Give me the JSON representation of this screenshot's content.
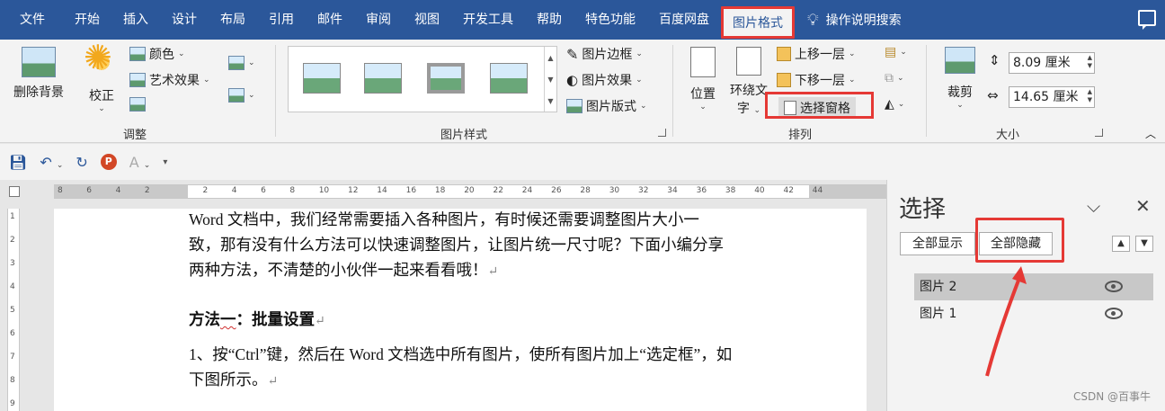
{
  "tabs": [
    {
      "label": "文件"
    },
    {
      "label": "开始"
    },
    {
      "label": "插入"
    },
    {
      "label": "设计"
    },
    {
      "label": "布局"
    },
    {
      "label": "引用"
    },
    {
      "label": "邮件"
    },
    {
      "label": "审阅"
    },
    {
      "label": "视图"
    },
    {
      "label": "开发工具"
    },
    {
      "label": "帮助"
    },
    {
      "label": "特色功能"
    },
    {
      "label": "百度网盘"
    },
    {
      "label": "图片格式"
    }
  ],
  "tell_me": "操作说明搜索",
  "ribbon": {
    "adjust": {
      "remove_bg": "删除背景",
      "correct": "校正",
      "color": "颜色",
      "artistic": "艺术效果",
      "group_label": "调整"
    },
    "styles": {
      "border": "图片边框",
      "effects": "图片效果",
      "layout": "图片版式",
      "group_label": "图片样式"
    },
    "arrange": {
      "position": "位置",
      "wrap_line1": "环绕文",
      "wrap_line2": "字",
      "bring_forward": "上移一层",
      "send_backward": "下移一层",
      "selection_pane": "选择窗格",
      "group_label": "排列"
    },
    "size": {
      "crop": "裁剪",
      "height": "8.09 厘米",
      "width": "14.65 厘米",
      "group_label": "大小"
    }
  },
  "document": {
    "para1_line1": "Word 文档中，我们经常需要插入各种图片，有时候还需要调整图片大小一",
    "para1_line2": "致，那有没有什么方法可以快速调整图片，让图片统一尺寸呢？下面小编分享",
    "para1_line3": "两种方法，不清楚的小伙伴一起来看看哦！",
    "heading_a": "方法",
    "heading_b": "一",
    "heading_c": "：批量设置",
    "step1_line1": "1、按“Ctrl”键，然后在 Word 文档选中所有图片，使所有图片加上“选定框”，如",
    "step1_line2": "下图所示。",
    "para_mark": "↵"
  },
  "ruler": {
    "h_ticks": [
      "8",
      "6",
      "4",
      "2",
      "",
      "2",
      "4",
      "6",
      "8",
      "10",
      "12",
      "14",
      "16",
      "18",
      "20",
      "22",
      "24",
      "26",
      "28",
      "30",
      "32",
      "34",
      "36",
      "38",
      "40",
      "42",
      "44"
    ],
    "v_ticks": [
      "1",
      "2",
      "3",
      "4",
      "5",
      "6",
      "7",
      "8",
      "9"
    ]
  },
  "pane": {
    "title": "选择",
    "show_all": "全部显示",
    "hide_all": "全部隐藏",
    "items": [
      {
        "label": "图片 2"
      },
      {
        "label": "图片 1"
      }
    ]
  },
  "watermark": "CSDN @百事牛",
  "colors": {
    "accent": "#2b579a",
    "highlight": "#e53935"
  }
}
